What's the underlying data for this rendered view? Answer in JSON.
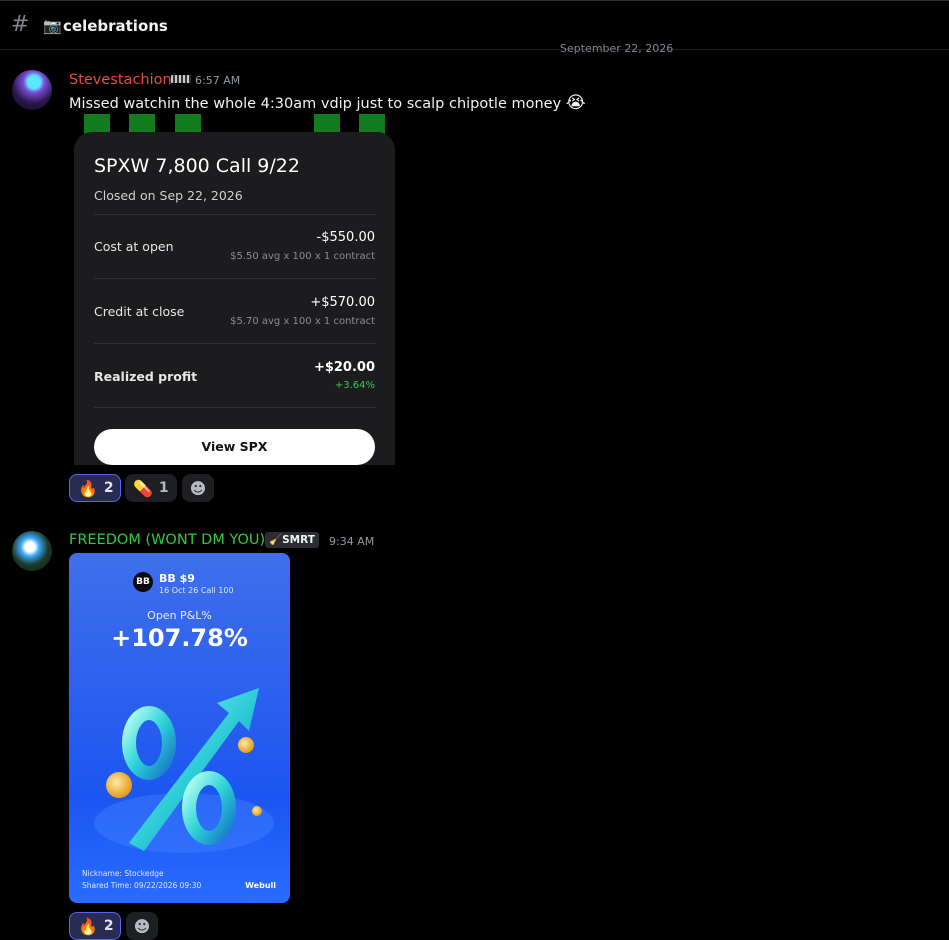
{
  "channel": {
    "icon": "hash-icon",
    "emoji": "📷",
    "name": "celebrations"
  },
  "divider_date": "September 22, 2026",
  "messages": [
    {
      "author": "Stevestachion",
      "author_color": "#e74c3c",
      "time": "6:57 AM",
      "text": "Missed watchin the whole 4:30am vdip just to scalp chipotle money",
      "emoji": "😭",
      "attachment": {
        "title": "SPXW 7,800 Call 9/22",
        "subtitle": "Closed on Sep 22, 2026",
        "rows": [
          {
            "label": "Cost at open",
            "value": "-$550.00",
            "detail": "$5.50 avg x 100 x 1 contract"
          },
          {
            "label": "Credit at close",
            "value": "+$570.00",
            "detail": "$5.70 avg x 100 x 1 contract"
          },
          {
            "label": "Realized profit",
            "value": "+$20.00",
            "detail": "+3.64%"
          }
        ],
        "button": "View SPX"
      },
      "reactions": [
        {
          "emoji": "🔥",
          "count": "2",
          "active": true
        },
        {
          "emoji": "💊",
          "count": "1",
          "active": false
        }
      ]
    },
    {
      "author": "FREEDOM (WONT DM YOU)",
      "author_color": "#2ecc40",
      "badge_emoji": "🧹",
      "badge": "SMRT",
      "time": "9:34 AM",
      "attachment": {
        "logo": "BB",
        "ticker": "BB $9",
        "contract": "16 Oct 26 Call 100",
        "pnl_label": "Open P&L%",
        "pnl_value": "+107.78%",
        "nickname": "Nickname: Stockedge",
        "shared_time": "Shared Time: 09/22/2026 09:30",
        "brand": "Webull"
      },
      "reactions": [
        {
          "emoji": "🔥",
          "count": "2",
          "active": true
        }
      ]
    }
  ],
  "add_reaction_icon": "smiley-face-icon"
}
